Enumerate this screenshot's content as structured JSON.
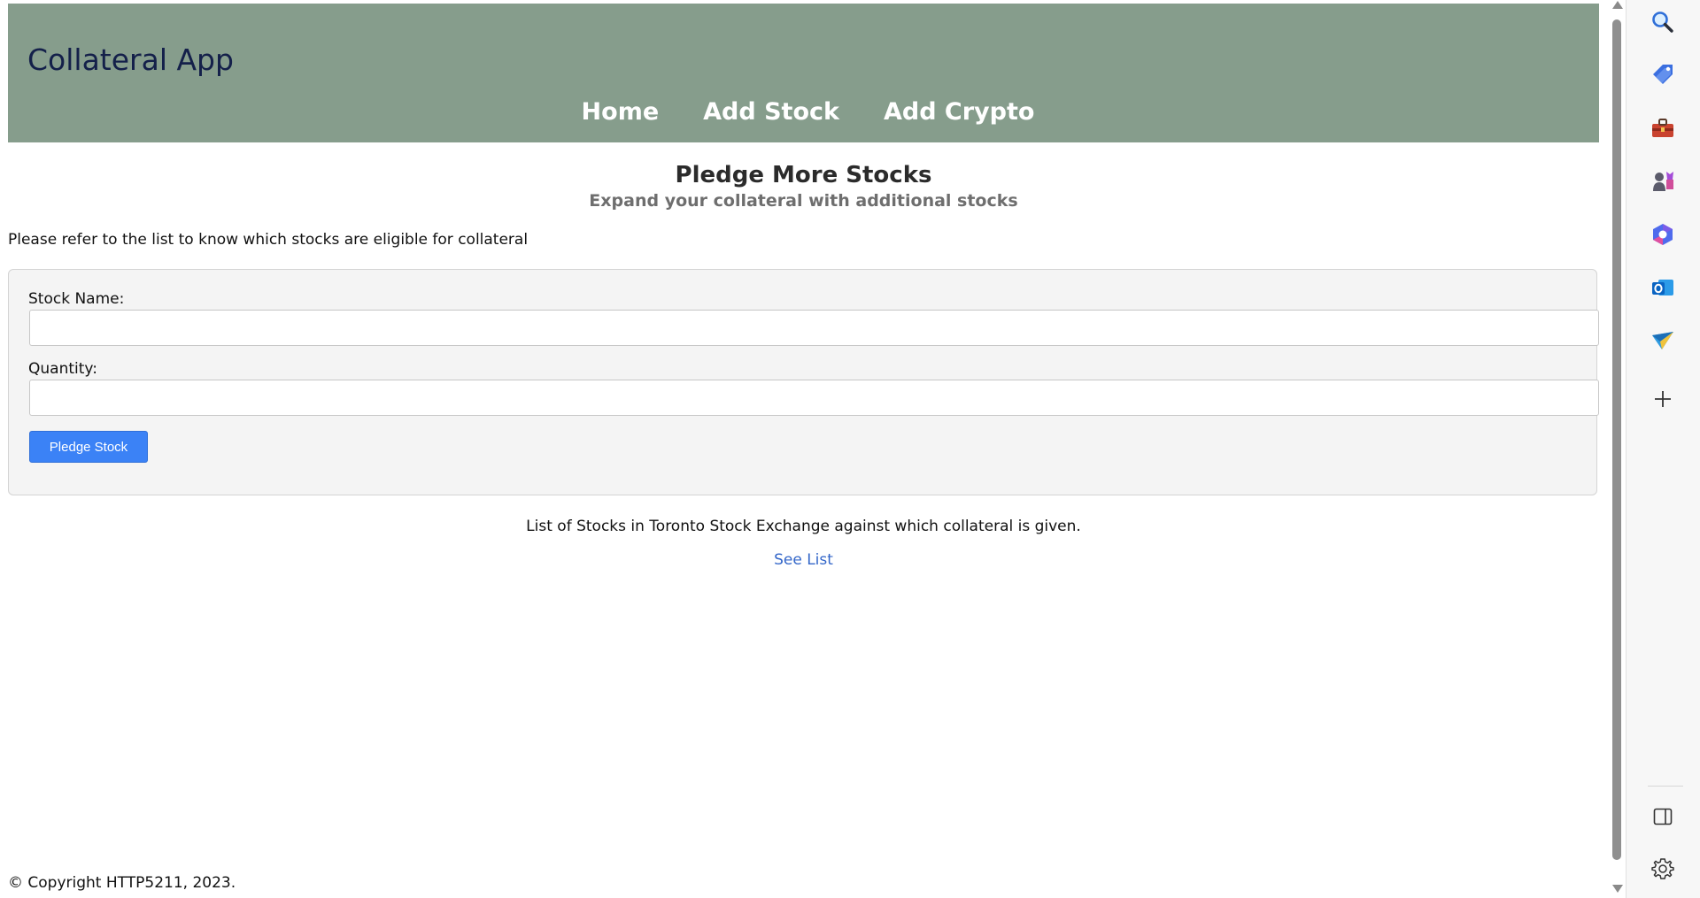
{
  "app": {
    "title": "Collateral App",
    "nav": [
      {
        "label": "Home"
      },
      {
        "label": "Add Stock"
      },
      {
        "label": "Add Crypto"
      }
    ]
  },
  "page": {
    "heading": "Pledge More Stocks",
    "subheading": "Expand your collateral with additional stocks",
    "eligibility_note": "Please refer to the list to know which stocks are eligible for collateral"
  },
  "form": {
    "stock_name_label": "Stock Name:",
    "stock_name_value": "",
    "quantity_label": "Quantity:",
    "quantity_value": "",
    "submit_label": "Pledge Stock"
  },
  "stock_list": {
    "note": "List of Stocks in Toronto Stock Exchange against which collateral is given.",
    "link_label": "See List"
  },
  "footer": {
    "copyright": "© Copyright HTTP5211, 2023."
  },
  "colors": {
    "header_bg": "#869d8c",
    "title_color": "#14204a",
    "primary_button": "#3b82f6",
    "link": "#3467c9"
  },
  "side_panel": {
    "icons": [
      "search-icon",
      "tag-icon",
      "toolbox-icon",
      "games-icon",
      "copilot-icon",
      "outlook-icon",
      "send-icon",
      "add-icon",
      "split-view-icon",
      "settings-icon"
    ]
  }
}
